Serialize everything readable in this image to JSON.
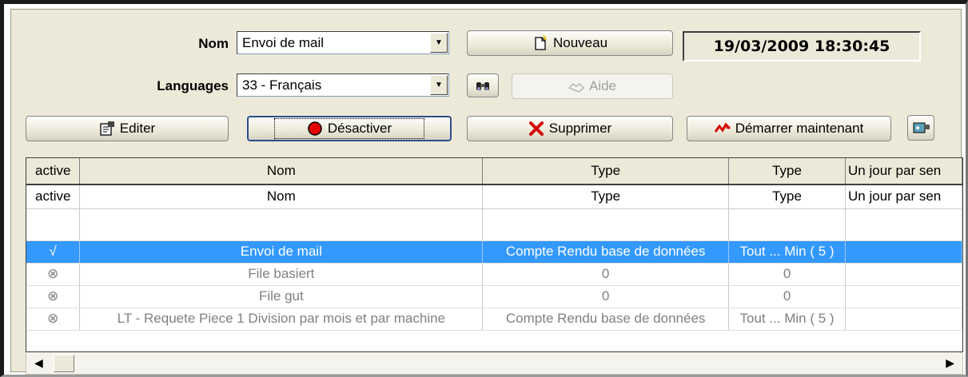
{
  "form": {
    "nom_label": "Nom",
    "nom_value": "Envoi de mail",
    "languages_label": "Languages",
    "languages_value": "33 - Français",
    "datetime": "19/03/2009 18:30:45"
  },
  "buttons": {
    "nouveau": "Nouveau",
    "aide": "Aide",
    "editer": "Editer",
    "desactiver": "Désactiver",
    "supprimer": "Supprimer",
    "demarrer": "Démarrer maintenant"
  },
  "icons": {
    "nouveau": "new-document-icon",
    "search": "binoculars-icon",
    "aide": "handshake-icon",
    "editer": "edit-properties-icon",
    "desactiver": "red-record-icon",
    "supprimer": "red-x-icon",
    "demarrer": "red-arrows-icon",
    "extra": "cassette-tool-icon"
  },
  "grid": {
    "headers": [
      "active",
      "Nom",
      "Type",
      "Type",
      "Un jour par sen"
    ],
    "filter": [
      "active",
      "Nom",
      "Type",
      "Type",
      "Un jour par sen"
    ],
    "rows": [
      {
        "state": "√",
        "nom": "Envoi de mail",
        "type1": "Compte Rendu base de données",
        "type2": "Tout ... Min ( 5 )",
        "jour": ""
      },
      {
        "state": "⊗",
        "nom": "File basiert",
        "type1": "0",
        "type2": "0",
        "jour": ""
      },
      {
        "state": "⊗",
        "nom": "File gut",
        "type1": "0",
        "type2": "0",
        "jour": ""
      },
      {
        "state": "⊗",
        "nom": "LT - Requete Piece 1 Division par mois et par machine",
        "type1": "Compte Rendu base de données",
        "type2": "Tout ... Min ( 5 )",
        "jour": ""
      }
    ]
  },
  "colors": {
    "panel": "#ece9d8",
    "selection": "#3399ff",
    "accent_red": "#d40000"
  }
}
